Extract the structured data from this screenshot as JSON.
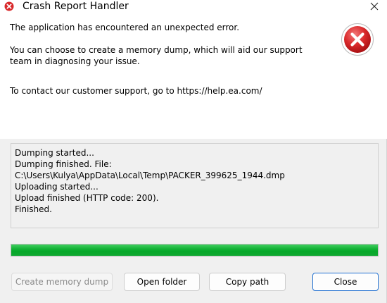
{
  "window": {
    "title": "Crash Report Handler",
    "title_icon": "error-icon",
    "close_icon": "close-icon"
  },
  "message": {
    "line1": "The application has encountered an unexpected error.",
    "line2": "You can choose to create a memory dump, which will aid our support",
    "line3": "team in diagnosing your issue.",
    "line4": "To contact our customer support, go to https://help.ea.com/",
    "icon": "error-icon"
  },
  "log": {
    "lines": [
      "Dumping started...",
      "Dumping finished. File:",
      "C:\\Users\\Kulya\\AppData\\Local\\Temp\\PACKER_399625_1944.dmp",
      "Uploading started...",
      "Upload finished (HTTP code: 200).",
      "Finished."
    ]
  },
  "progress": {
    "percent": 100,
    "color": "#06a82a"
  },
  "buttons": {
    "create_dump": "Create memory dump",
    "open_folder": "Open folder",
    "copy_path": "Copy path",
    "close": "Close"
  },
  "colors": {
    "error_red": "#d9292b",
    "accent_blue": "#1f6fd0"
  }
}
